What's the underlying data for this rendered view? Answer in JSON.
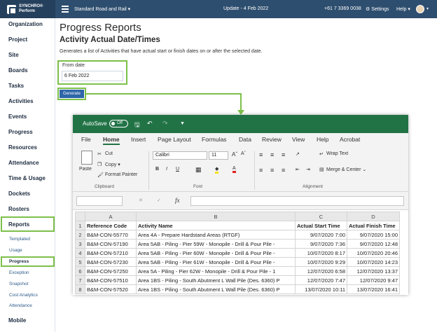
{
  "topbar": {
    "brand_line1": "SYNCHRO®",
    "brand_line2": "Perform",
    "project": "Standard Road and Rail ▾",
    "update": "Update - 4 Feb 2022",
    "phone": "+61 7 3369 0038",
    "settings": "⚙ Settings",
    "help": "Help ▾",
    "avatar_caret": "▾"
  },
  "sidebar": {
    "items": [
      "Organization",
      "Project",
      "Site",
      "Boards",
      "Tasks",
      "Activities",
      "Events",
      "Progress",
      "Resources",
      "Attendance",
      "Time & Usage",
      "Dockets",
      "Rosters",
      "Reports",
      "Mobile"
    ],
    "sub_items": [
      "Templated",
      "Usage",
      "Progress",
      "Exception",
      "Snapshot",
      "Cost Analytics",
      "Attendance"
    ],
    "highlighted": [
      "Reports",
      "Progress"
    ]
  },
  "main": {
    "title": "Progress Reports",
    "subtitle": "Activity Actual Date/Times",
    "description": "Generates a list of Activities that have actual start or finish dates on or after the selected date.",
    "from_date_label": "From date",
    "from_date_value": "6 Feb 2022",
    "generate_label": "Generate",
    "accent_color": "#7cc04a"
  },
  "excel": {
    "autosave": "AutoSave",
    "toggle": "Off",
    "menu": [
      "File",
      "Home",
      "Insert",
      "Page Layout",
      "Formulas",
      "Data",
      "Review",
      "View",
      "Help",
      "Acrobat"
    ],
    "active_menu": "Home",
    "ribbon": {
      "cut": "Cut",
      "copy": "Copy ▾",
      "paste": "Paste",
      "format_painter": "Format Painter",
      "clipboard": "Clipboard",
      "font_name": "Calibri",
      "font_size": "11",
      "font_group": "Font",
      "wrap_text": "Wrap Text",
      "merge_center": "Merge & Center ⌄",
      "alignment": "Alignment",
      "bold": "B",
      "italic": "I",
      "underline": "U"
    },
    "formula_bar": {
      "fx": "fx"
    },
    "columns": [
      "A",
      "B",
      "C",
      "D"
    ],
    "headers": [
      "Reference Code",
      "Activity Name",
      "Actual Start Time",
      "Actual Finish Time"
    ],
    "rows": [
      [
        "B&M-CON-55770",
        "Area 4A - Prepare Hardstand Areas (RTGF)",
        "9/07/2020 7:00",
        "9/07/2020 15:00"
      ],
      [
        "B&M-CON-57190",
        "Area 5AB - Piling - Pier 59W - Monopile - Drill & Pour Pile -",
        "9/07/2020 7:36",
        "9/07/2020 12:48"
      ],
      [
        "B&M-CON-57210",
        "Area 5AB - Piling - Pier 60W - Monopile - Drill & Pour Pile -",
        "10/07/2020 8:17",
        "10/07/2020 20:46"
      ],
      [
        "B&M-CON-57230",
        "Area 5AB - Piling - Pier 61W - Monopile - Drill & Pour Pile -",
        "10/07/2020 9:29",
        "10/07/2020 14:23"
      ],
      [
        "B&M-CON-57250",
        "Area 5A - Piling - Pier 62W - Monopile - Drill & Pour Pile - 1",
        "12/07/2020 6:58",
        "12/07/2020 13:37"
      ],
      [
        "B&M-CON-57510",
        "Area 1BS - Piling - South Abutment L Wall Pile (Des. 6360) P",
        "12/07/2020 7:47",
        "12/07/2020 9:47"
      ],
      [
        "B&M-CON-57520",
        "Area 1BS - Piling - South Abutment L Wall Pile (Des. 6360) P",
        "13/07/2020 10:11",
        "13/07/2020 16:41"
      ]
    ],
    "row_numbers": [
      "1",
      "2",
      "3",
      "4",
      "5",
      "6",
      "7",
      "8"
    ],
    "brand_color": "#217346"
  }
}
